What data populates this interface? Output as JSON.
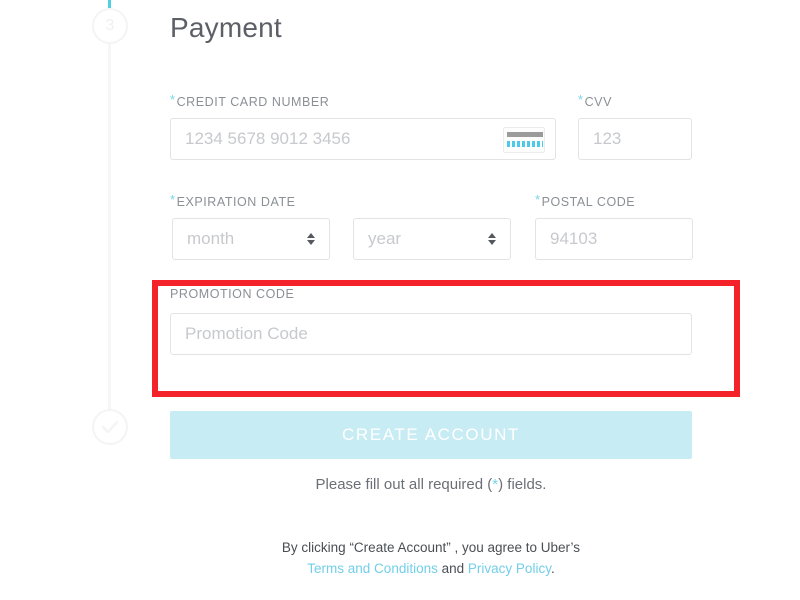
{
  "stepper": {
    "current_step_number": "3",
    "current_step_icon": "step-number-circle",
    "completed_step_icon": "check-circle-icon",
    "active_rail_color": "#4fd1e0",
    "inactive_rail_color": "#f6f6f7"
  },
  "form": {
    "title": "Payment",
    "required_marker": "*",
    "fields": {
      "credit_card_number": {
        "label": "CREDIT CARD NUMBER",
        "required": true,
        "value": "",
        "placeholder": "1234 5678 9012 3456",
        "trailing_icon": "credit-card-icon"
      },
      "cvv": {
        "label": "CVV",
        "required": true,
        "value": "",
        "placeholder": "123"
      },
      "expiration_date": {
        "label": "EXPIRATION DATE",
        "required": true,
        "month": {
          "selected": "month",
          "placeholder": "month"
        },
        "year": {
          "selected": "year",
          "placeholder": "year"
        }
      },
      "postal_code": {
        "label": "POSTAL CODE",
        "required": true,
        "value": "",
        "placeholder": "94103"
      },
      "promotion_code": {
        "label": "PROMOTION CODE",
        "required": false,
        "value": "",
        "placeholder": "Promotion Code",
        "highlighted": true,
        "highlight_color": "#f42229"
      }
    },
    "submit": {
      "label": "CREATE ACCOUNT",
      "disabled": true,
      "background_color": "#c8ecf3",
      "text_color": "#ffffff"
    },
    "required_note": {
      "prefix": "Please fill out all required (",
      "star": "*",
      "suffix": ") fields."
    },
    "legal": {
      "line1": "By clicking “Create Account” , you agree to Uber’s",
      "terms_link": "Terms and Conditions",
      "conjunction": "and",
      "privacy_link": "Privacy Policy",
      "period": ".",
      "link_color": "#72cfe8"
    }
  }
}
